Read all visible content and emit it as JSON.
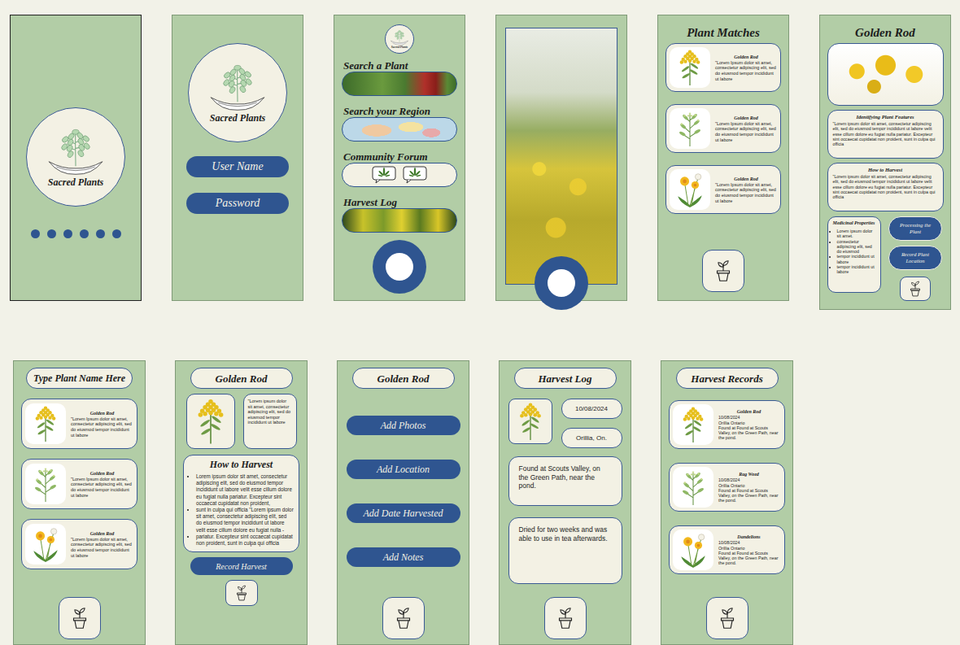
{
  "splash": {
    "logo_text": "Sacred Plants",
    "page_dots": [
      {
        "selected": false
      },
      {
        "selected": false
      },
      {
        "selected": false
      },
      {
        "selected": false
      },
      {
        "selected": false
      },
      {
        "selected": false
      }
    ]
  },
  "login": {
    "logo_text": "Sacred Plants",
    "fields": [
      {
        "label": "User Name"
      },
      {
        "label": "Password"
      }
    ]
  },
  "home": {
    "logo_text": "Sacred Plants",
    "menu": [
      {
        "label": "Search a Plant",
        "kind": "leaves"
      },
      {
        "label": "Search your Region",
        "kind": "map"
      },
      {
        "label": "Community Forum",
        "kind": "forum"
      },
      {
        "label": "Harvest Log",
        "kind": "goldenrod"
      }
    ]
  },
  "plant_matches": {
    "title": "Plant Matches",
    "results": [
      {
        "name": "Golden Rod",
        "description": "\"Lorem Ipsum dolor sit amet, consectetur adipiscing elit, sed do eiusmod tempor incididunt ut labore",
        "kind": "goldenrod"
      },
      {
        "name": "Golden Rod",
        "description": "\"Lorem Ipsum dolor sit amet, consectetur adipiscing elit, sed do eiusmod tempor incididunt ut labore",
        "kind": "ragweed"
      },
      {
        "name": "Golden Rod",
        "description": "\"Lorem Ipsum dolor sit amet, consectetur adipiscing elit, sed do eiusmod tempor incididunt ut labore",
        "kind": "dandelion"
      }
    ]
  },
  "plant_detail": {
    "title": "Golden Rod",
    "sections": [
      {
        "heading": "Identifying Plant Features",
        "body": "\"Lorem ipsum dolor sit amet, consectetur adipiscing elit, sed do eiusmod tempor incididunt ut labore velit esse cillum dolore eu fugiat nulla pariatur. Excepteur sint occaecat cupidatat non proident, sunt in culpa qui officia"
      },
      {
        "heading": "How to Harvest",
        "body": "\"Lorem ipsum dolor sit amet, consectetur adipiscing elit, sed do eiusmod tempor incididunt ut labore velit esse cillum dolore eu fugiat nulla pariatur. Excepteur sint occaecat cupidatat non proident, sunt in culpa qui officia"
      }
    ],
    "medicinal": {
      "heading": "Medicinal Properties",
      "items": [
        "Lorem ipsum dolor sit amet.",
        "consectetur adipiscing elit, sed do eiusmod",
        "tempor incididunt ut labore",
        "tempor incididunt ut labore"
      ]
    },
    "buttons": [
      "Processing the Plant",
      "Record Plant Location"
    ]
  },
  "plant_search": {
    "placeholder": "Type Plant Name Here",
    "results": [
      {
        "name": "Golden Rod",
        "description": "\"Lorem Ipsum dolor sit amet, consectetur adipiscing elit, sed do eiusmod tempor incididunt ut labore",
        "kind": "goldenrod"
      },
      {
        "name": "Golden Rod",
        "description": "\"Lorem Ipsum dolor sit amet, consectetur adipiscing elit, sed do eiusmod tempor incididunt ut labore",
        "kind": "ragweed"
      },
      {
        "name": "Golden Rod",
        "description": "\"Lorem Ipsum dolor sit amet, consectetur adipiscing elit, sed do eiusmod tempor incididunt ut labore",
        "kind": "dandelion"
      }
    ]
  },
  "harvest_guide": {
    "title": "Golden Rod",
    "kind": "goldenrod",
    "blurb": "\"Lorem ipsum dolor sit amet, consectetur adipiscing elit, sed do eiusmod tempor incididunt ut labore",
    "heading": "How to Harvest",
    "items": [
      "Lorem ipsum dolor sit amet, consectetur adipiscing elit, sed do eiusmod tempor incididunt ut labore velit esse cillum dolore eu fugiat nulla pariatur. Excepteur sint occaecat cupidatat non proident,",
      "sunt in culpa qui officia \"Lorem ipsum dolor sit amet, consectetur adipiscing elit, sed do eiusmod tempor incididunt ut labore velit esse cillum dolore eu fugiat nulla -",
      "pariatur. Excepteur sint occaecat cupidatat non proident, sunt in culpa qui officia"
    ],
    "button": "Record Harvest"
  },
  "record_harvest": {
    "title": "Golden Rod",
    "actions": [
      "Add Photos",
      "Add Location",
      "Add Date Harvested",
      "Add Notes"
    ]
  },
  "harvest_log": {
    "title": "Harvest Log",
    "kind": "goldenrod",
    "date": "10/08/2024",
    "place": "Orillia, On.",
    "notes": [
      "Found at Scouts Valley, on the Green Path, near the pond.",
      "Dried for two weeks and was able to use in tea afterwards."
    ]
  },
  "harvest_records": {
    "title": "Harvest Records",
    "entries": [
      {
        "name": "Golden Rod",
        "date": "10/08/2024",
        "place": "Orillia Ontario",
        "note": "Found at Found at Scouts Valley, on the Green Path, near the pond.",
        "kind": "goldenrod"
      },
      {
        "name": "Rag Weed",
        "date": "10/08/2024",
        "place": "Orillia Ontario",
        "note": "Found at Found at Scouts Valley, on the Green Path, near the pond.",
        "kind": "ragweed"
      },
      {
        "name": "Dandelions",
        "date": "10/08/2024",
        "place": "Orillia Ontario",
        "note": "Found at Found at Scouts Valley, on the Green Path, near the pond.",
        "kind": "dandelion"
      }
    ]
  }
}
